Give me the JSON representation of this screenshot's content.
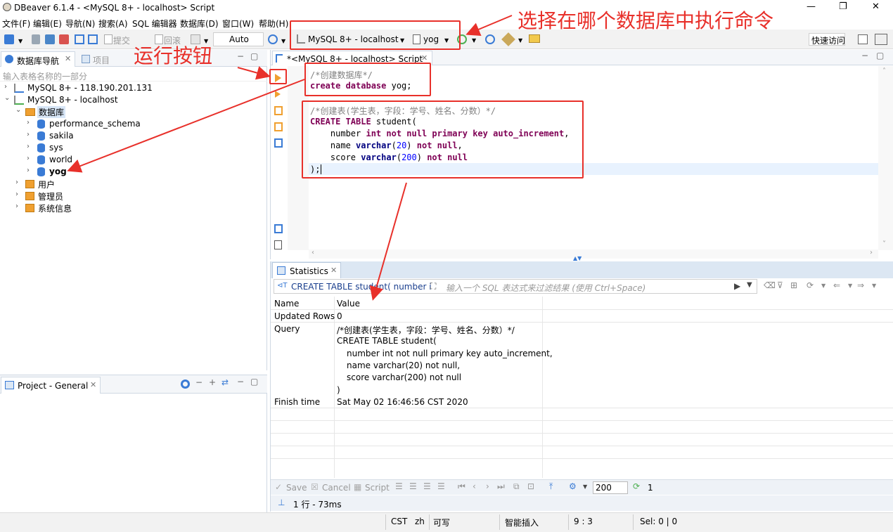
{
  "window": {
    "title": "DBeaver 6.1.4 - <MySQL 8+ - localhost> Script",
    "minimize": "—",
    "restore": "❐",
    "close": "✕"
  },
  "menu": [
    "文件(F)",
    "编辑(E)",
    "导航(N)",
    "搜索(A)",
    "SQL 编辑器",
    "数据库(D)",
    "窗口(W)",
    "帮助(H)"
  ],
  "toolbar": {
    "commit": "提交",
    "rollback": "回滚",
    "mode": "Auto",
    "connection": "MySQL 8+ - localhost",
    "database": "yog",
    "quick_access": "快速访问"
  },
  "navigator": {
    "tab_title": "数据库导航",
    "tab2_title": "项目",
    "filter_placeholder": "输入表格名称的一部分",
    "tree": [
      {
        "label": "MySQL 8+ - 118.190.201.131"
      },
      {
        "label": "MySQL 8+ - localhost"
      },
      {
        "label": "数据库"
      },
      {
        "label": "performance_schema"
      },
      {
        "label": "sakila"
      },
      {
        "label": "sys"
      },
      {
        "label": "world"
      },
      {
        "label": "yog"
      },
      {
        "label": "用户"
      },
      {
        "label": "管理员"
      },
      {
        "label": "系统信息"
      }
    ]
  },
  "project_panel": {
    "title": "Project - General"
  },
  "editor": {
    "tab_title": "*<MySQL 8+ - localhost> Script",
    "lines": {
      "l1": "/*创建数据库*/",
      "l2_kw": "create database",
      "l2_rest": " yog;",
      "l3": "/*创建表(学生表，字段：学号、姓名、分数）*/",
      "l4_kw": "CREATE TABLE",
      "l4_rest": " student(",
      "l5_a": "    number ",
      "l5_b": "int not null primary key auto_increment",
      "l5_c": ",",
      "l6_a": "    name ",
      "l6_b": "varchar",
      "l6_c": "(",
      "l6_d": "20",
      "l6_e": ") ",
      "l6_f": "not null",
      "l6_g": ",",
      "l7_a": "    score ",
      "l7_b": "varchar",
      "l7_c": "(",
      "l7_d": "200",
      "l7_e": ") ",
      "l7_f": "not null",
      "l8": ");"
    }
  },
  "results": {
    "tab_title": "Statistics",
    "query_label": "CREATE TABLE student( number i",
    "filter_placeholder": "输入一个 SQL 表达式来过滤结果 (使用 Ctrl+Space)",
    "header": {
      "name": "Name",
      "value": "Value"
    },
    "rows": [
      {
        "name": "Updated Rows",
        "value": "0"
      },
      {
        "name": "Query",
        "value": "/*创建表(学生表，字段：学号、姓名、分数）*/"
      },
      {
        "name": "",
        "value": "CREATE TABLE student("
      },
      {
        "name": "",
        "value": "number int not null primary key auto_increment,"
      },
      {
        "name": "",
        "value": "name varchar(20) not null,"
      },
      {
        "name": "",
        "value": "score varchar(200) not null"
      },
      {
        "name": "",
        "value": ")"
      },
      {
        "name": "Finish time",
        "value": "Sat May 02 16:46:56 CST 2020"
      }
    ],
    "bottom": {
      "save": "Save",
      "cancel": "Cancel",
      "script": "Script",
      "fetch_size": "200",
      "refresh_count": "1",
      "row_info": "1 行 - 73ms"
    }
  },
  "statusbar": {
    "tz": "CST",
    "locale": "zh",
    "write": "可写",
    "insert": "智能插入",
    "pos": "9 : 3",
    "sel": "Sel: 0 | 0"
  },
  "annotations": {
    "select_db": "选择在哪个数据库中执行命令",
    "run_button": "运行按钮"
  },
  "colors": {
    "accent_red": "#e8302a",
    "tab_blue": "#dce7f3",
    "selection": "#e8f2fe"
  }
}
